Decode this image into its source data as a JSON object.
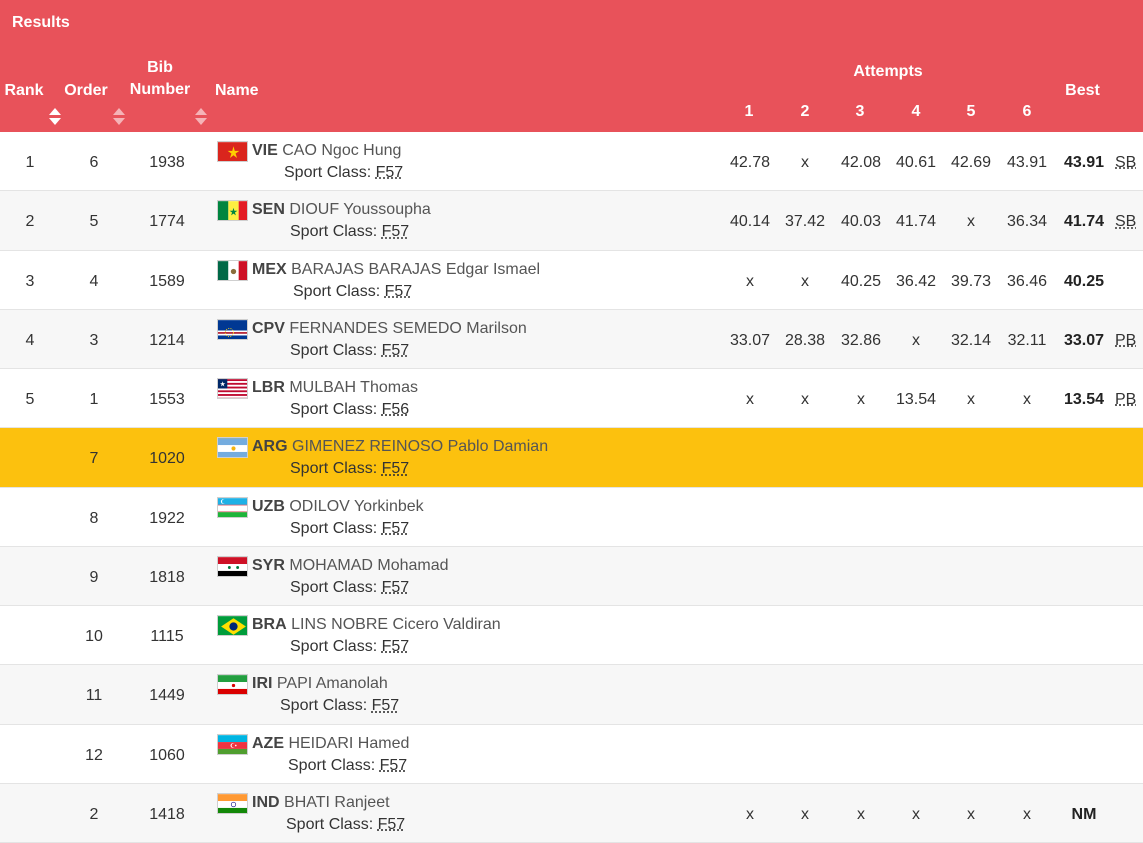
{
  "header": {
    "title": "Results",
    "rank": "Rank",
    "order": "Order",
    "bib_line1": "Bib",
    "bib_line2": "Number",
    "name": "Name",
    "attempts": "Attempts",
    "attempt_numbers": [
      "1",
      "2",
      "3",
      "4",
      "5",
      "6"
    ],
    "best": "Best",
    "colors": {
      "bg": "#e8525a",
      "text": "#ffffff",
      "highlight": "#fcc10e"
    }
  },
  "rows": [
    {
      "rank": "1",
      "order": "6",
      "bib": "1938",
      "noc": "VIE",
      "name": "CAO Ngoc Hung",
      "sport_label": "Sport Class:",
      "sport_class": "F57",
      "attempts": [
        "42.78",
        "x",
        "42.08",
        "40.61",
        "42.69",
        "43.91"
      ],
      "best": "43.91",
      "record": "SB",
      "flag": "vietnam-flag-icon"
    },
    {
      "rank": "2",
      "order": "5",
      "bib": "1774",
      "noc": "SEN",
      "name": "DIOUF Youssoupha",
      "sport_label": "Sport Class:",
      "sport_class": "F57",
      "attempts": [
        "40.14",
        "37.42",
        "40.03",
        "41.74",
        "x",
        "36.34"
      ],
      "best": "41.74",
      "record": "SB",
      "flag": "senegal-flag-icon"
    },
    {
      "rank": "3",
      "order": "4",
      "bib": "1589",
      "noc": "MEX",
      "name": "BARAJAS BARAJAS Edgar Ismael",
      "sport_label": "Sport Class:",
      "sport_class": "F57",
      "attempts": [
        "x",
        "x",
        "40.25",
        "36.42",
        "39.73",
        "36.46"
      ],
      "best": "40.25",
      "record": "",
      "flag": "mexico-flag-icon"
    },
    {
      "rank": "4",
      "order": "3",
      "bib": "1214",
      "noc": "CPV",
      "name": "FERNANDES SEMEDO Marilson",
      "sport_label": "Sport Class:",
      "sport_class": "F57",
      "attempts": [
        "33.07",
        "28.38",
        "32.86",
        "x",
        "32.14",
        "32.11"
      ],
      "best": "33.07",
      "record": "PB",
      "flag": "cape-verde-flag-icon"
    },
    {
      "rank": "5",
      "order": "1",
      "bib": "1553",
      "noc": "LBR",
      "name": "MULBAH Thomas",
      "sport_label": "Sport Class:",
      "sport_class": "F56",
      "attempts": [
        "x",
        "x",
        "x",
        "13.54",
        "x",
        "x"
      ],
      "best": "13.54",
      "record": "PB",
      "flag": "liberia-flag-icon"
    },
    {
      "rank": "",
      "order": "7",
      "bib": "1020",
      "noc": "ARG",
      "name": "GIMENEZ REINOSO Pablo Damian",
      "sport_label": "Sport Class:",
      "sport_class": "F57",
      "attempts": [
        "",
        "",
        "",
        "",
        "",
        ""
      ],
      "best": "",
      "record": "",
      "flag": "argentina-flag-icon"
    },
    {
      "rank": "",
      "order": "8",
      "bib": "1922",
      "noc": "UZB",
      "name": "ODILOV Yorkinbek",
      "sport_label": "Sport Class:",
      "sport_class": "F57",
      "attempts": [
        "",
        "",
        "",
        "",
        "",
        ""
      ],
      "best": "",
      "record": "",
      "flag": "uzbekistan-flag-icon"
    },
    {
      "rank": "",
      "order": "9",
      "bib": "1818",
      "noc": "SYR",
      "name": "MOHAMAD Mohamad",
      "sport_label": "Sport Class:",
      "sport_class": "F57",
      "attempts": [
        "",
        "",
        "",
        "",
        "",
        ""
      ],
      "best": "",
      "record": "",
      "flag": "syria-flag-icon"
    },
    {
      "rank": "",
      "order": "10",
      "bib": "1115",
      "noc": "BRA",
      "name": "LINS NOBRE Cicero Valdiran",
      "sport_label": "Sport Class:",
      "sport_class": "F57",
      "attempts": [
        "",
        "",
        "",
        "",
        "",
        ""
      ],
      "best": "",
      "record": "",
      "flag": "brazil-flag-icon"
    },
    {
      "rank": "",
      "order": "11",
      "bib": "1449",
      "noc": "IRI",
      "name": "PAPI Amanolah",
      "sport_label": "Sport Class:",
      "sport_class": "F57",
      "attempts": [
        "",
        "",
        "",
        "",
        "",
        ""
      ],
      "best": "",
      "record": "",
      "flag": "iran-flag-icon"
    },
    {
      "rank": "",
      "order": "12",
      "bib": "1060",
      "noc": "AZE",
      "name": "HEIDARI Hamed",
      "sport_label": "Sport Class:",
      "sport_class": "F57",
      "attempts": [
        "",
        "",
        "",
        "",
        "",
        ""
      ],
      "best": "",
      "record": "",
      "flag": "azerbaijan-flag-icon"
    },
    {
      "rank": "",
      "order": "2",
      "bib": "1418",
      "noc": "IND",
      "name": "BHATI Ranjeet",
      "sport_label": "Sport Class:",
      "sport_class": "F57",
      "attempts": [
        "x",
        "x",
        "x",
        "x",
        "x",
        "x"
      ],
      "best": "NM",
      "record": "",
      "flag": "india-flag-icon"
    }
  ]
}
